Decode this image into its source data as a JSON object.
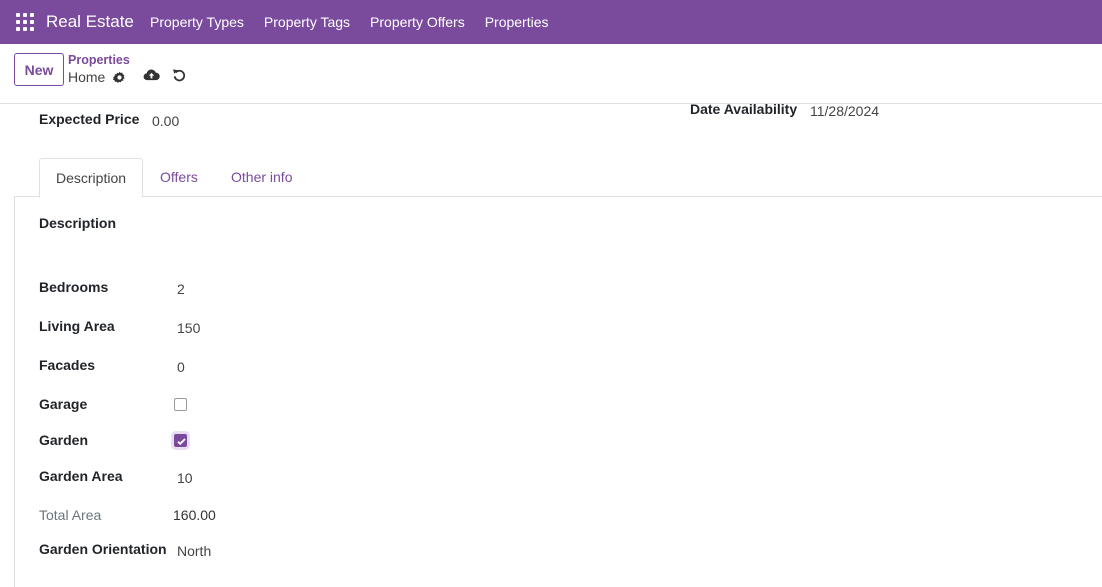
{
  "navbar": {
    "app_icon": "apps-grid-icon",
    "brand": "Real Estate",
    "menu": [
      "Property Types",
      "Property Tags",
      "Property Offers",
      "Properties"
    ],
    "color": "#7a4b9c"
  },
  "control": {
    "new_label": "New",
    "breadcrumb_parent": "Properties",
    "breadcrumb_current": "Home",
    "icons": [
      "gear-icon",
      "cloud-upload-icon",
      "undo-icon"
    ]
  },
  "form": {
    "expected_price_label": "Expected Price",
    "expected_price": "0.00",
    "date_availability_label": "Date Availability",
    "date_availability": "11/28/2024"
  },
  "tabs": [
    {
      "label": "Description",
      "active": true
    },
    {
      "label": "Offers",
      "active": false
    },
    {
      "label": "Other info",
      "active": false
    }
  ],
  "description_tab": {
    "section_label": "Description",
    "bedrooms_label": "Bedrooms",
    "bedrooms": "2",
    "living_area_label": "Living Area",
    "living_area": "150",
    "facades_label": "Facades",
    "facades": "0",
    "garage_label": "Garage",
    "garage": false,
    "garden_label": "Garden",
    "garden": true,
    "garden_area_label": "Garden Area",
    "garden_area": "10",
    "total_area_label": "Total Area",
    "total_area": "160.00",
    "garden_orientation_label": "Garden Orientation",
    "garden_orientation": "North"
  }
}
